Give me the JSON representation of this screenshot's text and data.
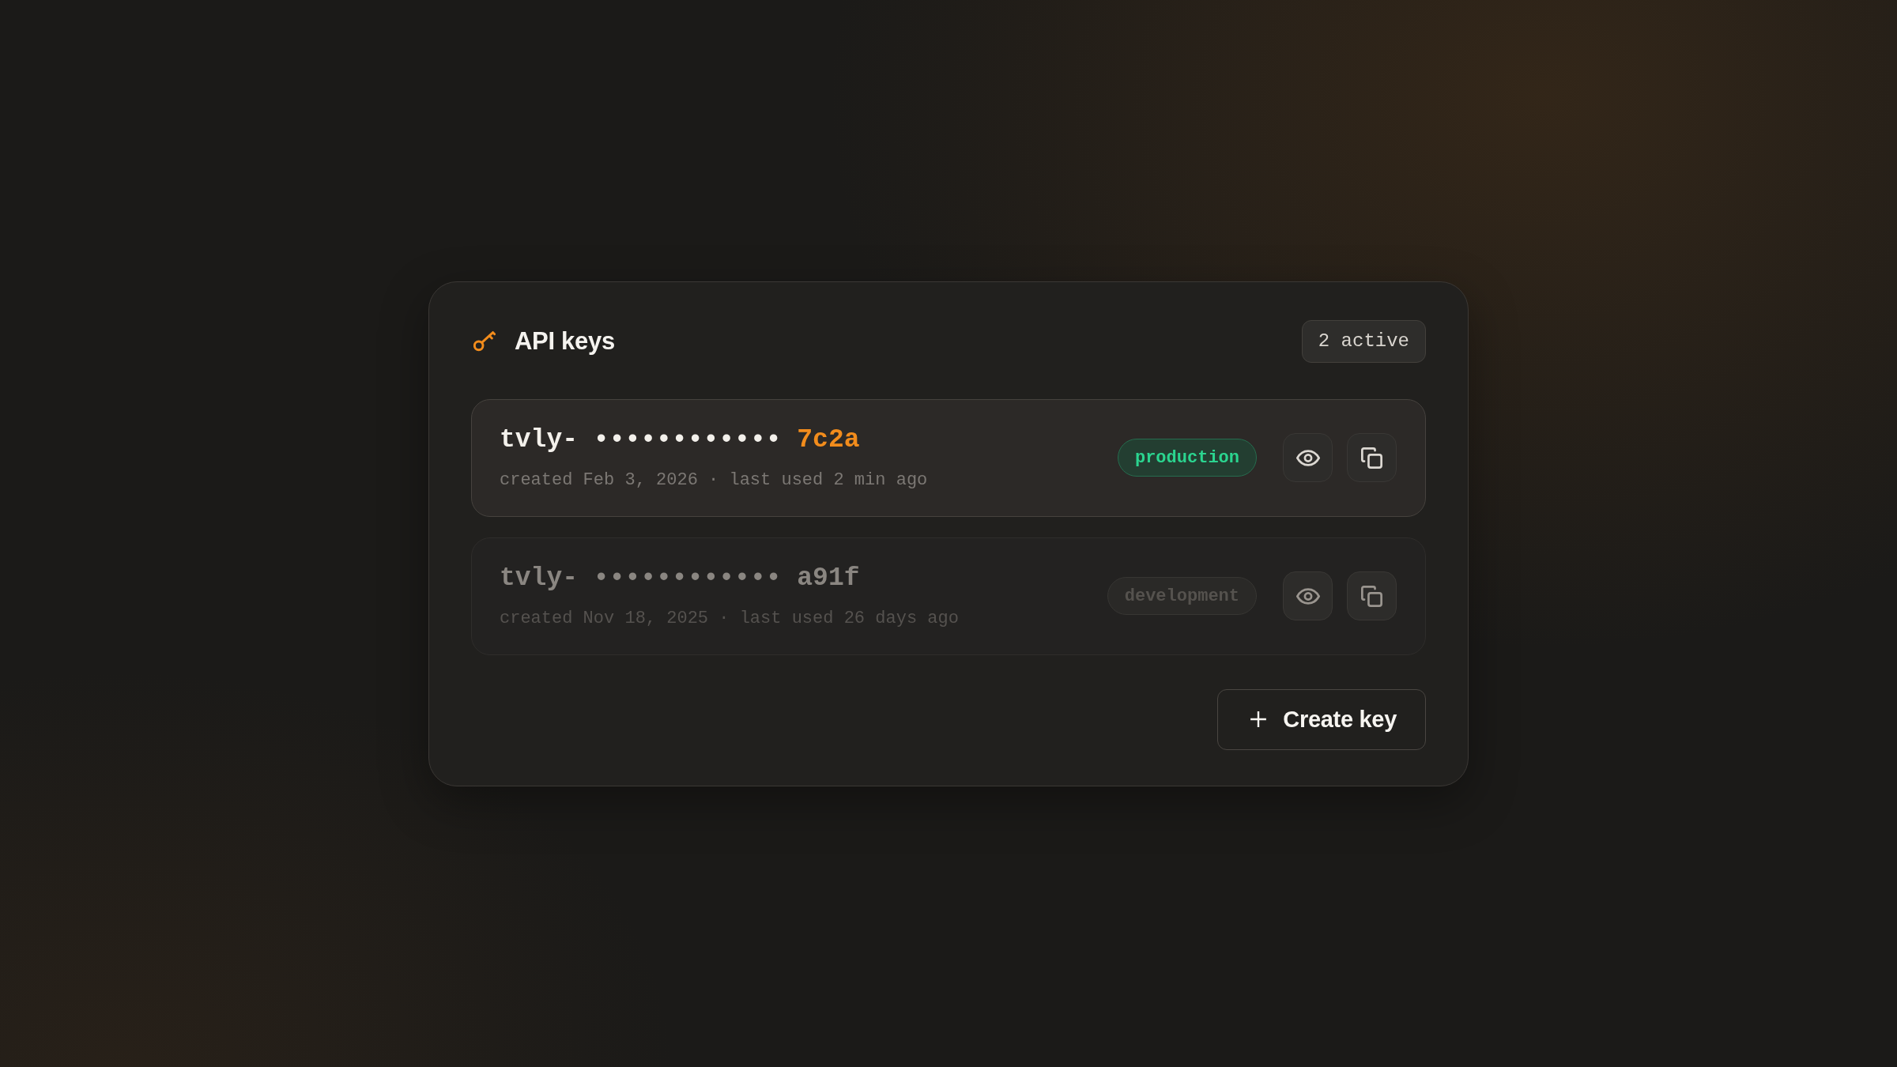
{
  "header": {
    "title": "API keys",
    "badge": "2 active"
  },
  "keys": [
    {
      "prefix": "tvly-",
      "mask": "••••••••••••",
      "suffix": "7c2a",
      "meta": "created Feb 3, 2026 · last used 2 min ago",
      "tag": {
        "label": "production",
        "color": "#2bd48f"
      },
      "selected": true
    },
    {
      "prefix": "tvly-",
      "mask": "••••••••••••",
      "suffix": "a91f",
      "meta": "created Nov 18, 2025 · last used 26 days ago",
      "tag": {
        "label": "development",
        "color": "#55524e"
      },
      "selected": false
    }
  ],
  "create_button": {
    "label": "Create key"
  }
}
